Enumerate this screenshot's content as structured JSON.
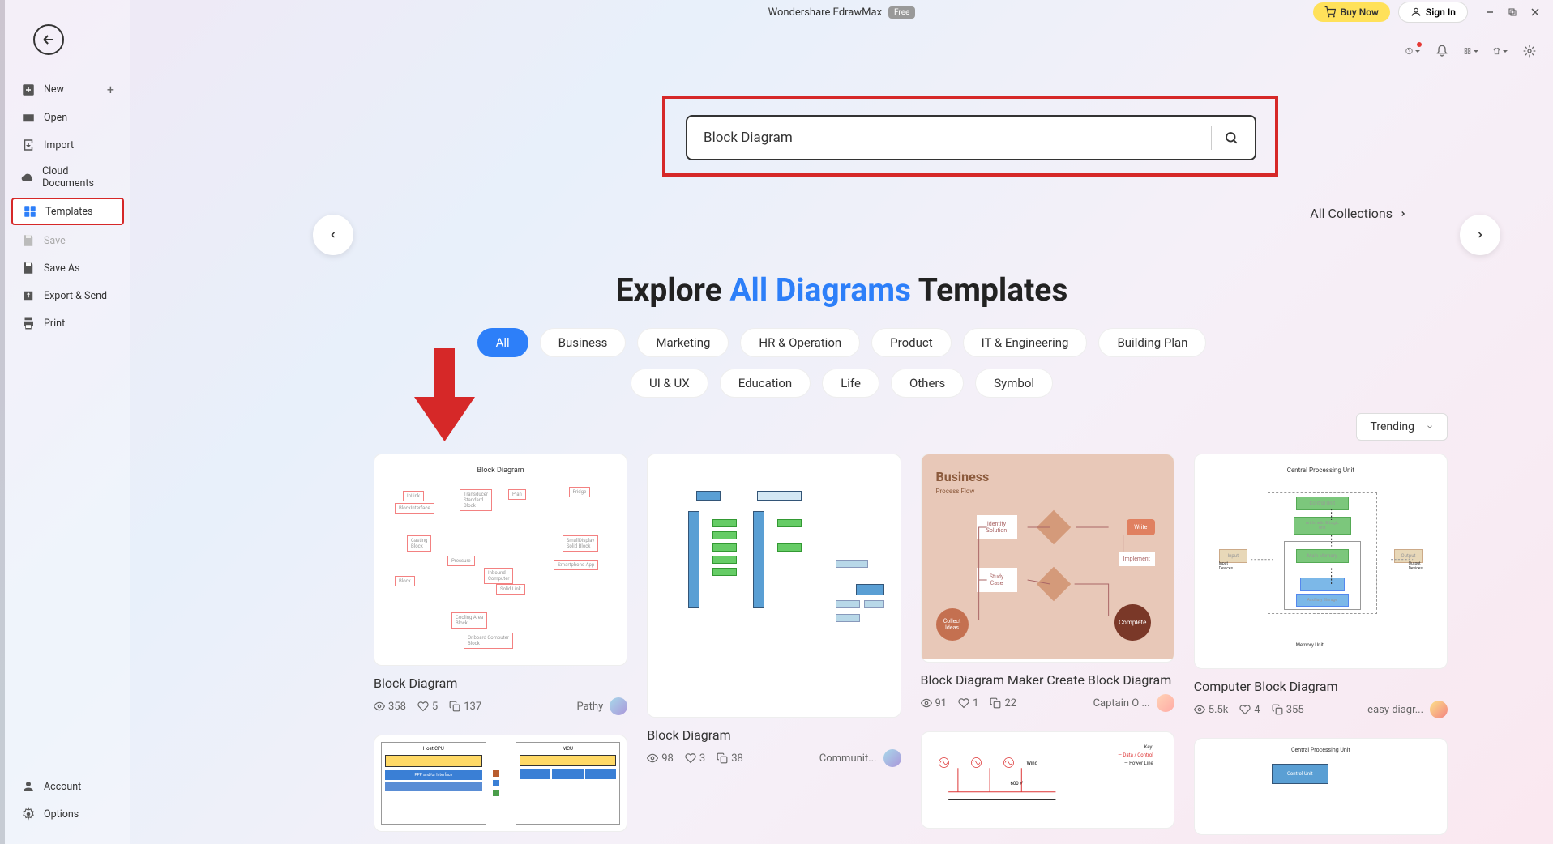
{
  "app": {
    "title": "Wondershare EdrawMax",
    "badge": "Free"
  },
  "header": {
    "buy": "Buy Now",
    "signin": "Sign In"
  },
  "sidebar": {
    "new": "New",
    "open": "Open",
    "import": "Import",
    "cloud": "Cloud Documents",
    "templates": "Templates",
    "save": "Save",
    "saveas": "Save As",
    "export": "Export & Send",
    "print": "Print",
    "account": "Account",
    "options": "Options"
  },
  "search": {
    "value": "Block Diagram"
  },
  "collections_link": "All Collections",
  "heading": {
    "part1": "Explore ",
    "part2": "All Diagrams",
    "part3": " Templates"
  },
  "categories": {
    "row1": [
      "All",
      "Business",
      "Marketing",
      "HR & Operation",
      "Product",
      "IT & Engineering",
      "Building Plan"
    ],
    "row2": [
      "UI & UX",
      "Education",
      "Life",
      "Others",
      "Symbol"
    ]
  },
  "sort": "Trending",
  "cards": [
    {
      "title": "Block Diagram",
      "views": "358",
      "likes": "5",
      "copies": "137",
      "author": "Pathy"
    },
    {
      "title": "Block Diagram",
      "views": "98",
      "likes": "3",
      "copies": "38",
      "author": "Communit..."
    },
    {
      "title": "Block Diagram Maker Create Block Diagram",
      "views": "91",
      "likes": "1",
      "copies": "22",
      "author": "Captain O ..."
    },
    {
      "title": "Computer Block Diagram",
      "views": "5.5k",
      "likes": "4",
      "copies": "355",
      "author": "easy diagr..."
    }
  ],
  "thumb1": {
    "title": "Block Diagram"
  },
  "thumb3": {
    "header": "Business",
    "sub": "Process Flow"
  },
  "thumb4": {
    "title": "Central Processing Unit"
  }
}
